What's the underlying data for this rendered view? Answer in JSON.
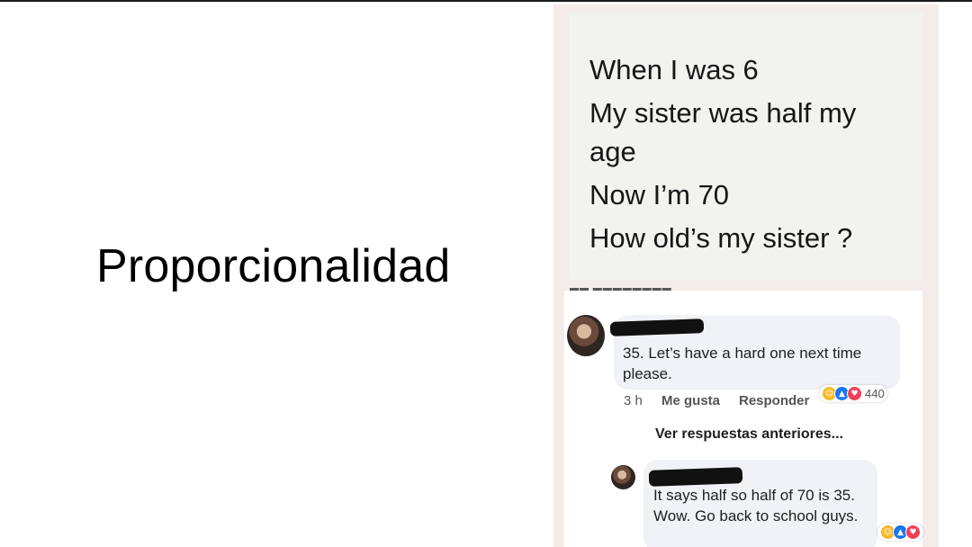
{
  "slide": {
    "title": "Proporcionalidad"
  },
  "question": {
    "lines": [
      "When I was 6",
      "My sister was half my",
      "age",
      "Now I’m 70",
      "How old’s my sister ?"
    ]
  },
  "comments": {
    "first": {
      "text": "35. Let’s have a hard one next time please.",
      "time": "3 h",
      "like_label": "Me gusta",
      "reply_label": "Responder",
      "reaction_count": "440",
      "reaction_icons": [
        "haha-icon",
        "like-icon",
        "love-icon"
      ]
    },
    "view_more_label": "Ver respuestas anteriores...",
    "reply": {
      "text": "It says half so half of 70 is 35. Wow. Go back to school guys.",
      "reaction_icons": [
        "haha-icon",
        "like-icon",
        "love-icon"
      ]
    }
  },
  "colors": {
    "like": "#1877f2",
    "love": "#f33e58",
    "haha": "#f7b928",
    "bubble": "#f0f2f5"
  }
}
